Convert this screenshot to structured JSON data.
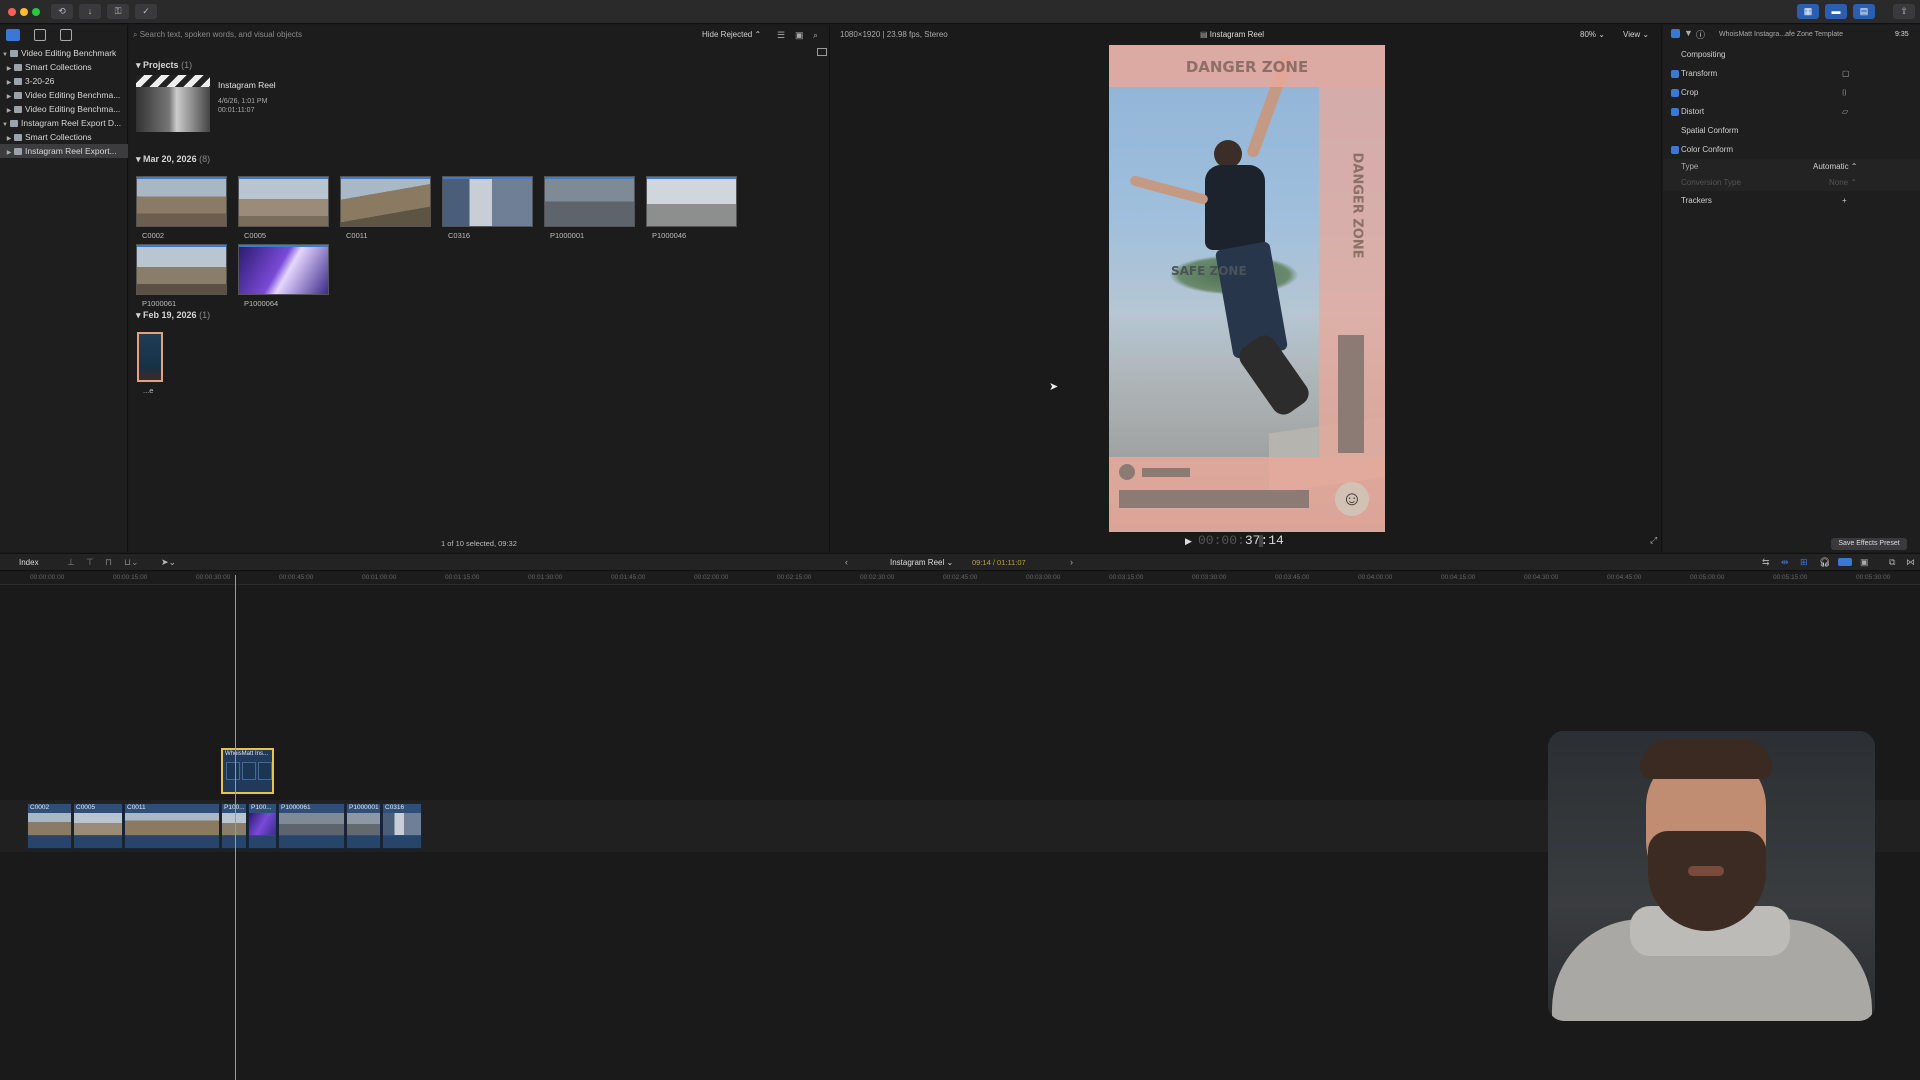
{
  "titlebar": {
    "left_buttons": [
      "⟲",
      "↓",
      "⚿",
      "✓"
    ],
    "right_buttons": [
      "▦",
      "▬",
      "▤"
    ]
  },
  "sidebar": {
    "items": [
      {
        "label": "Video Editing Benchmark",
        "level": 0,
        "expanded": true,
        "selected": false
      },
      {
        "label": "Smart Collections",
        "level": 1,
        "expanded": false,
        "selected": false
      },
      {
        "label": "3-20-26",
        "level": 1,
        "expanded": false,
        "selected": false
      },
      {
        "label": "Video Editing Benchma...",
        "level": 1,
        "expanded": false,
        "selected": false
      },
      {
        "label": "Video Editing Benchma...",
        "level": 1,
        "expanded": false,
        "selected": false
      },
      {
        "label": "Instagram Reel Export D...",
        "level": 0,
        "expanded": true,
        "selected": false
      },
      {
        "label": "Smart Collections",
        "level": 1,
        "expanded": false,
        "selected": false
      },
      {
        "label": "Instagram Reel Export...",
        "level": 1,
        "expanded": false,
        "selected": true
      }
    ]
  },
  "browser": {
    "filter": "Hide Rejected",
    "search_placeholder": "Search text, spoken words, and visual objects",
    "projects_header": "Projects",
    "projects_count": "(1)",
    "project": {
      "name": "Instagram Reel",
      "date": "4/6/26, 1:01 PM",
      "duration": "00:01:11:07"
    },
    "group1_header": "Mar 20, 2026",
    "group1_count": "(8)",
    "group1_clips": [
      "C0002",
      "C0005",
      "C0011",
      "C0316",
      "P1000001",
      "P1000046",
      "P1000061",
      "P1000064"
    ],
    "group2_header": "Feb 19, 2026",
    "group2_count": "(1)",
    "group2_clip": "...e",
    "status": "1 of 10 selected, 09:32"
  },
  "viewer": {
    "format": "1080×1920 | 23.98 fps, Stereo",
    "title": "Instagram Reel",
    "zoom": "80%",
    "view_menu": "View",
    "overlay_top": "DANGER ZONE",
    "overlay_right": "DANGER ZONE",
    "overlay_safe": "SAFE ZONE",
    "timecode_dim": "00:00:",
    "timecode_bright": "37:14"
  },
  "inspector": {
    "title": "WhoisMatt Instagra...afe Zone Template",
    "duration": "9:35",
    "sections": {
      "compositing": "Compositing",
      "transform": "Transform",
      "crop": "Crop",
      "distort": "Distort",
      "spatial_conform": "Spatial Conform",
      "color_conform": "Color Conform",
      "type_label": "Type",
      "type_value": "Automatic ⌃",
      "conversion_label": "Conversion Type",
      "conversion_value": "None ⌃",
      "trackers": "Trackers",
      "trackers_add": "+"
    },
    "save_preset": "Save Effects Preset"
  },
  "timeline": {
    "index_label": "Index",
    "project_name": "Instagram Reel",
    "position": "09:14 / 01:11:07",
    "ruler_ticks": [
      "00:00:00:00",
      "00:00:15:00",
      "00:00:30:00",
      "00:00:45:00",
      "00:01:00:00",
      "00:01:15:00",
      "00:01:30:00",
      "00:01:45:00",
      "00:02:00:00",
      "00:02:15:00",
      "00:02:30:00",
      "00:02:45:00",
      "00:03:00:00",
      "00:03:15:00",
      "00:03:30:00",
      "00:03:45:00",
      "00:04:00:00",
      "00:04:15:00",
      "00:04:30:00",
      "00:04:45:00",
      "00:05:00:00",
      "00:05:15:00",
      "00:05:30:00"
    ],
    "connected_clip": "WhoisMatt Ins...",
    "clips": [
      "C0002",
      "C0005",
      "C0011",
      "P100...",
      "P100...",
      "P1000061",
      "P1000001",
      "C0316"
    ]
  },
  "colors": {
    "accent_blue": "#3a78d8",
    "selection_yellow": "#e6c34a",
    "overlay_salmon": "#e9a89a"
  }
}
